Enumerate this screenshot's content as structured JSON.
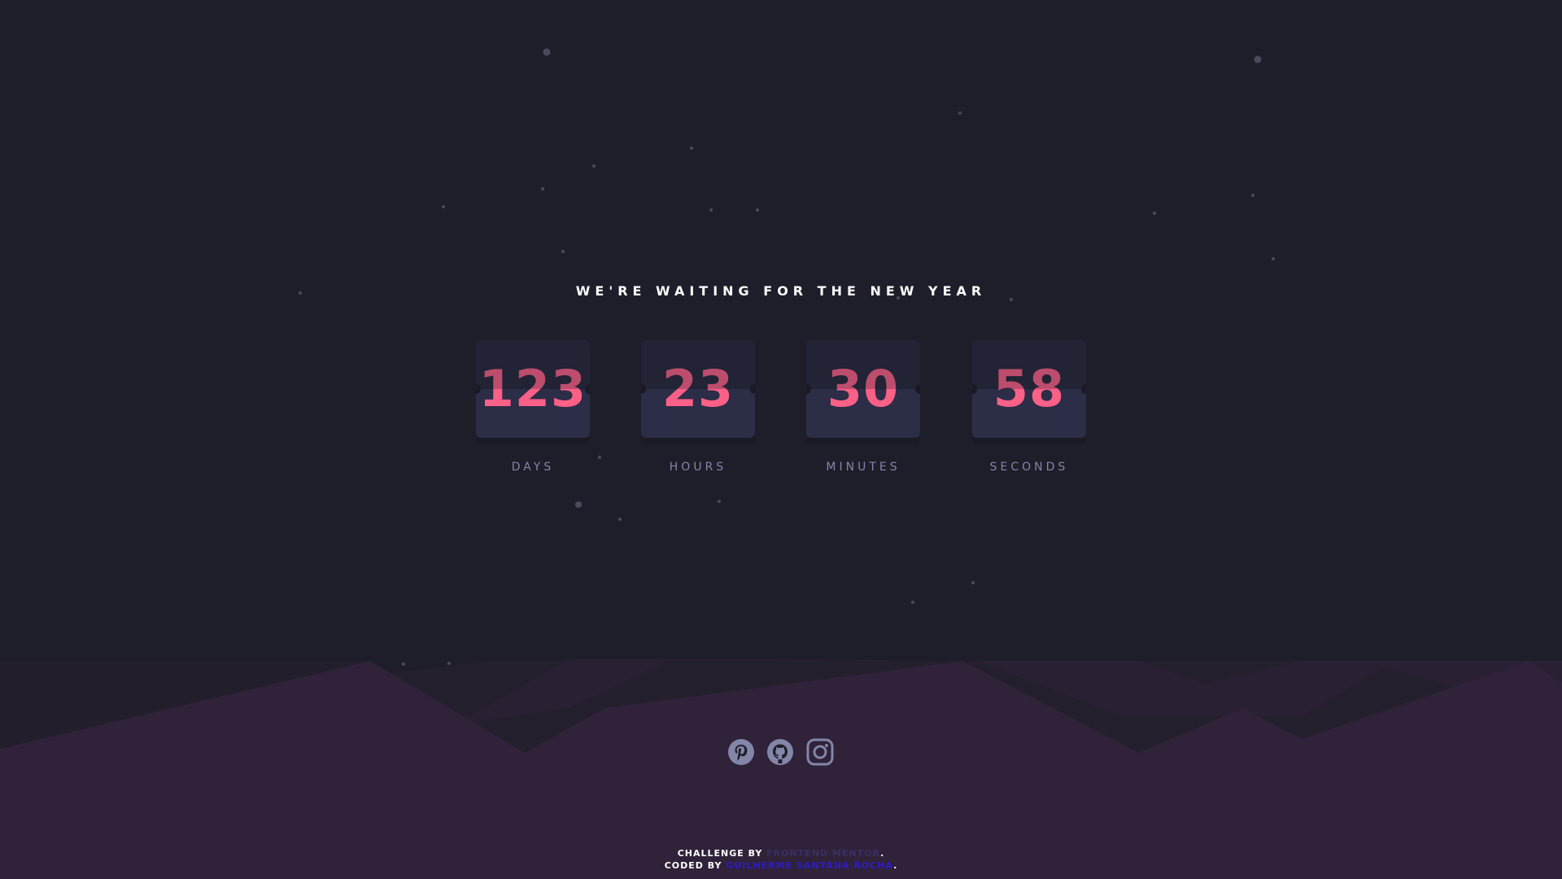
{
  "heading": "WE'RE WAITING FOR THE NEW YEAR",
  "countdown": {
    "days": {
      "value": "123",
      "label": "DAYS"
    },
    "hours": {
      "value": "23",
      "label": "HOURS"
    },
    "minutes": {
      "value": "30",
      "label": "MINUTES"
    },
    "seconds": {
      "value": "58",
      "label": "SECONDS"
    }
  },
  "social": [
    {
      "icon": "pinterest-icon"
    },
    {
      "icon": "github-icon"
    },
    {
      "icon": "instagram-icon"
    }
  ],
  "attribution": {
    "challenge_prefix": "CHALLENGE BY ",
    "challenge_link": "FRONTEND MENTOR",
    "challenge_suffix": ".",
    "coded_prefix": "CODED BY ",
    "coded_link": "GUILHERME SANTANA ROCHA",
    "coded_suffix": "."
  },
  "colors": {
    "background": "#1e1e2a",
    "accent": "#fb6087",
    "label": "#8385a9",
    "card": "#2c2d47",
    "hills": "#302239"
  }
}
